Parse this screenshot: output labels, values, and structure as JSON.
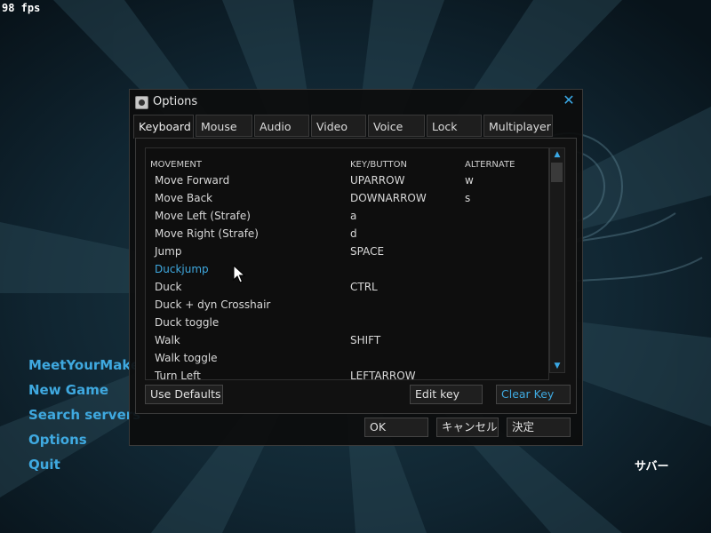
{
  "hud": {
    "fps": "98 fps"
  },
  "main_menu": {
    "items": [
      "MeetYourMake",
      "New Game",
      "Search servers",
      "Options",
      "Quit"
    ]
  },
  "server_label": "サバー",
  "dialog": {
    "title": "Options",
    "close_symbol": "✕",
    "tabs": [
      "Keyboard",
      "Mouse",
      "Audio",
      "Video",
      "Voice",
      "Lock",
      "Multiplayer"
    ],
    "active_tab": "Keyboard",
    "columns": [
      "MOVEMENT",
      "KEY/BUTTON",
      "ALTERNATE"
    ],
    "rows": [
      {
        "action": "Move Forward",
        "key": "UPARROW",
        "alt": "w"
      },
      {
        "action": "Move Back",
        "key": "DOWNARROW",
        "alt": "s"
      },
      {
        "action": "Move Left (Strafe)",
        "key": "a",
        "alt": ""
      },
      {
        "action": "Move Right (Strafe)",
        "key": "d",
        "alt": ""
      },
      {
        "action": "Jump",
        "key": "SPACE",
        "alt": ""
      },
      {
        "action": "Duckjump",
        "key": "",
        "alt": ""
      },
      {
        "action": "Duck",
        "key": "CTRL",
        "alt": ""
      },
      {
        "action": "Duck + dyn Crosshair",
        "key": "",
        "alt": ""
      },
      {
        "action": "Duck toggle",
        "key": "",
        "alt": ""
      },
      {
        "action": "Walk",
        "key": "SHIFT",
        "alt": ""
      },
      {
        "action": "Walk toggle",
        "key": "",
        "alt": ""
      },
      {
        "action": "Turn Left",
        "key": "LEFTARROW",
        "alt": ""
      }
    ],
    "highlighted_row": "Duckjump",
    "buttons": {
      "use_defaults": "Use Defaults",
      "edit_key": "Edit key",
      "clear_key": "Clear Key",
      "ok": "OK",
      "cancel": "キャンセル",
      "apply": "決定"
    }
  },
  "colors": {
    "accent": "#3fa9e0",
    "dialog_bg": "#0c0c0c"
  }
}
